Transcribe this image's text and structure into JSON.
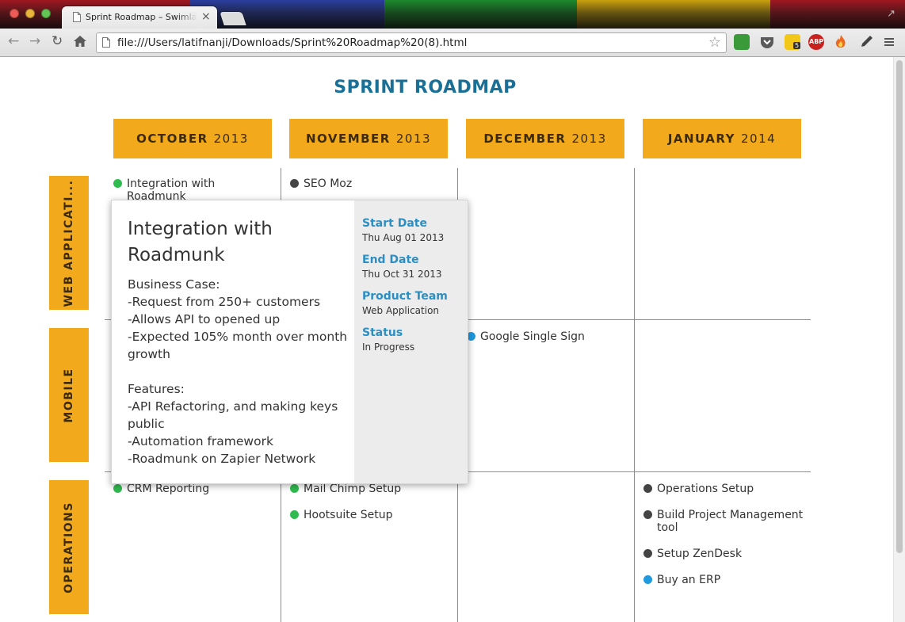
{
  "browser": {
    "tab_title": "Sprint Roadmap – Swimlane",
    "tab_close": "×",
    "url": "file:///Users/latifnanji/Downloads/Sprint%20Roadmap%20(8).html",
    "abp_label": "ABP",
    "ext_badge": "5",
    "icons": [
      "back-arrow-icon",
      "forward-arrow-icon",
      "reload-icon",
      "home-icon",
      "bookmark-star-icon",
      "menu-icon"
    ],
    "colors": {
      "stripe_blue": "#2b3e9e",
      "stripe_green": "#1d8a2c",
      "stripe_yellow": "#c9a10e",
      "stripe_red": "#a01821"
    }
  },
  "roadmap": {
    "title": "SPRINT ROADMAP",
    "accent": "#f2aa1c",
    "title_color": "#1a6f96",
    "months": [
      {
        "name": "OCTOBER",
        "year": "2013"
      },
      {
        "name": "NOVEMBER",
        "year": "2013"
      },
      {
        "name": "DECEMBER",
        "year": "2013"
      },
      {
        "name": "JANUARY",
        "year": "2014"
      }
    ],
    "lanes": [
      {
        "label": "WEB APPLICATI..."
      },
      {
        "label": "MOBILE"
      },
      {
        "label": "OPERATIONS"
      }
    ],
    "status_colors": {
      "green": "#2fbb4f",
      "dark": "#444444",
      "blue": "#1e9ae0"
    },
    "items": {
      "web_oct_1": "Integration with Roadmunk",
      "web_nov_1": "SEO Moz",
      "mobile_dec_1": "Google Single Sign",
      "ops_oct_1": "CRM Reporting",
      "ops_nov_1": "Mail Chimp Setup",
      "ops_nov_2": "Hootsuite Setup",
      "ops_jan_1": "Operations Setup",
      "ops_jan_2": "Build Project Management tool",
      "ops_jan_3": "Setup ZenDesk",
      "ops_jan_4": "Buy an ERP"
    }
  },
  "popover": {
    "title": "Integration with Roadmunk",
    "body_lines": [
      "Business Case:",
      "-Request from 250+ customers",
      "-Allows API to opened up",
      "-Expected 105% month over month growth",
      "",
      "Features:",
      "-API Refactoring, and making keys public",
      "-Automation framework",
      "-Roadmunk on Zapier Network"
    ],
    "fields": {
      "start_label": "Start Date",
      "start_value": "Thu Aug 01 2013",
      "end_label": "End Date",
      "end_value": "Thu Oct 31 2013",
      "team_label": "Product Team",
      "team_value": "Web Application",
      "status_label": "Status",
      "status_value": "In Progress"
    }
  }
}
